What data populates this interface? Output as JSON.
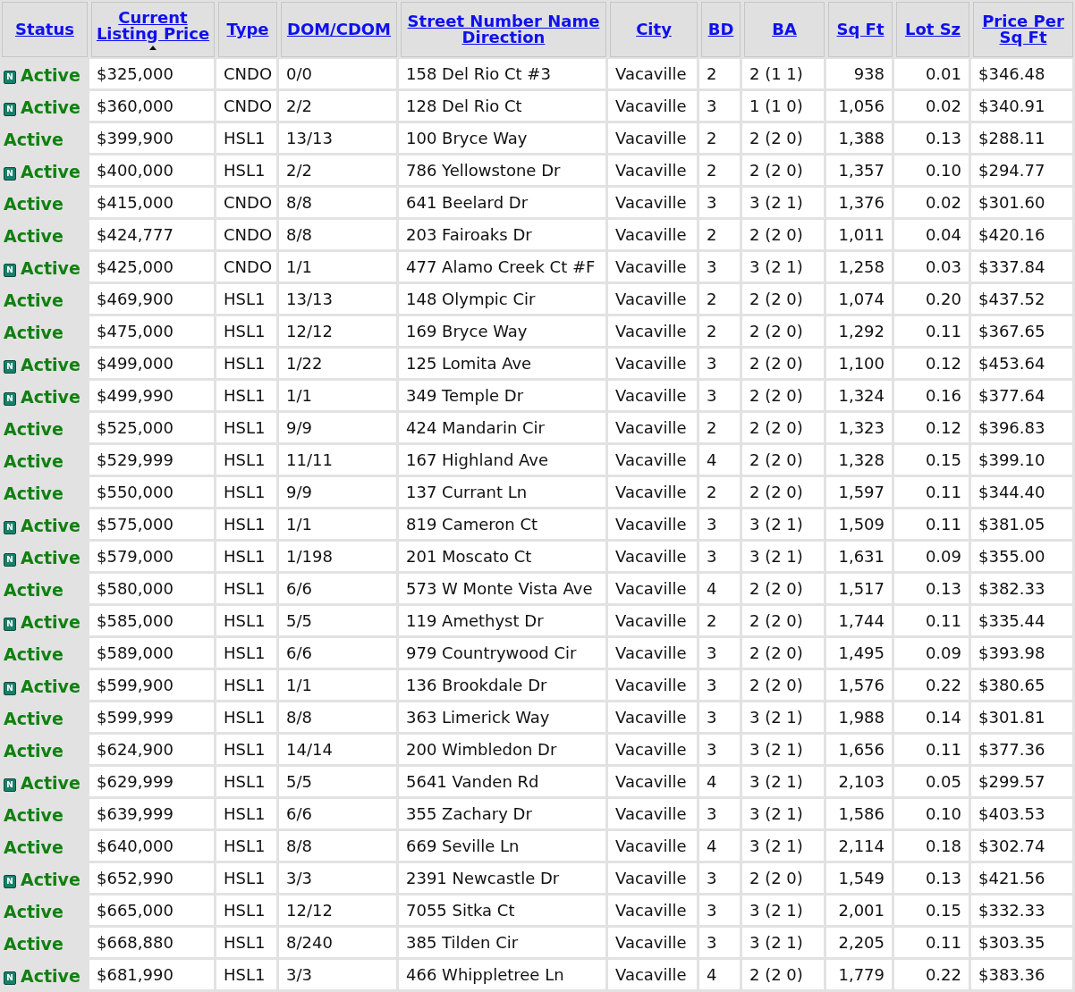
{
  "table": {
    "columns": [
      {
        "label": "Status",
        "sorted": false
      },
      {
        "label": "Current Listing Price",
        "sorted": true
      },
      {
        "label": "Type",
        "sorted": false
      },
      {
        "label": "DOM/CDOM",
        "sorted": false
      },
      {
        "label": "Street Number Name Direction",
        "sorted": false
      },
      {
        "label": "City",
        "sorted": false
      },
      {
        "label": "BD",
        "sorted": false
      },
      {
        "label": "BA",
        "sorted": false
      },
      {
        "label": "Sq Ft",
        "sorted": false
      },
      {
        "label": "Lot Sz",
        "sorted": false
      },
      {
        "label": "Price Per Sq Ft",
        "sorted": false
      }
    ],
    "rows": [
      {
        "badge": "N",
        "cells": [
          "Active",
          "$325,000",
          "CNDO",
          "0/0",
          "158 Del Rio Ct #3",
          "Vacaville",
          "2",
          "2 (1 1)",
          "938",
          "0.01",
          "$346.48"
        ]
      },
      {
        "badge": "N",
        "cells": [
          "Active",
          "$360,000",
          "CNDO",
          "2/2",
          "128 Del Rio Ct",
          "Vacaville",
          "3",
          "1 (1 0)",
          "1,056",
          "0.02",
          "$340.91"
        ]
      },
      {
        "cells": [
          "Active",
          "$399,900",
          "HSL1",
          "13/13",
          "100 Bryce Way",
          "Vacaville",
          "2",
          "2 (2 0)",
          "1,388",
          "0.13",
          "$288.11"
        ]
      },
      {
        "badge": "N",
        "cells": [
          "Active",
          "$400,000",
          "HSL1",
          "2/2",
          "786 Yellowstone Dr",
          "Vacaville",
          "2",
          "2 (2 0)",
          "1,357",
          "0.10",
          "$294.77"
        ]
      },
      {
        "cells": [
          "Active",
          "$415,000",
          "CNDO",
          "8/8",
          "641 Beelard Dr",
          "Vacaville",
          "3",
          "3 (2 1)",
          "1,376",
          "0.02",
          "$301.60"
        ]
      },
      {
        "cells": [
          "Active",
          "$424,777",
          "CNDO",
          "8/8",
          "203 Fairoaks Dr",
          "Vacaville",
          "2",
          "2 (2 0)",
          "1,011",
          "0.04",
          "$420.16"
        ]
      },
      {
        "badge": "N",
        "cells": [
          "Active",
          "$425,000",
          "CNDO",
          "1/1",
          "477 Alamo Creek Ct #F",
          "Vacaville",
          "3",
          "3 (2 1)",
          "1,258",
          "0.03",
          "$337.84"
        ]
      },
      {
        "cells": [
          "Active",
          "$469,900",
          "HSL1",
          "13/13",
          "148 Olympic Cir",
          "Vacaville",
          "2",
          "2 (2 0)",
          "1,074",
          "0.20",
          "$437.52"
        ]
      },
      {
        "cells": [
          "Active",
          "$475,000",
          "HSL1",
          "12/12",
          "169 Bryce Way",
          "Vacaville",
          "2",
          "2 (2 0)",
          "1,292",
          "0.11",
          "$367.65"
        ]
      },
      {
        "badge": "N",
        "cells": [
          "Active",
          "$499,000",
          "HSL1",
          "1/22",
          "125 Lomita Ave",
          "Vacaville",
          "3",
          "2 (2 0)",
          "1,100",
          "0.12",
          "$453.64"
        ]
      },
      {
        "badge": "N",
        "cells": [
          "Active",
          "$499,990",
          "HSL1",
          "1/1",
          "349 Temple Dr",
          "Vacaville",
          "3",
          "2 (2 0)",
          "1,324",
          "0.16",
          "$377.64"
        ]
      },
      {
        "cells": [
          "Active",
          "$525,000",
          "HSL1",
          "9/9",
          "424 Mandarin Cir",
          "Vacaville",
          "2",
          "2 (2 0)",
          "1,323",
          "0.12",
          "$396.83"
        ]
      },
      {
        "cells": [
          "Active",
          "$529,999",
          "HSL1",
          "11/11",
          "167 Highland Ave",
          "Vacaville",
          "4",
          "2 (2 0)",
          "1,328",
          "0.15",
          "$399.10"
        ]
      },
      {
        "cells": [
          "Active",
          "$550,000",
          "HSL1",
          "9/9",
          "137 Currant Ln",
          "Vacaville",
          "2",
          "2 (2 0)",
          "1,597",
          "0.11",
          "$344.40"
        ]
      },
      {
        "badge": "N",
        "cells": [
          "Active",
          "$575,000",
          "HSL1",
          "1/1",
          "819 Cameron Ct",
          "Vacaville",
          "3",
          "3 (2 1)",
          "1,509",
          "0.11",
          "$381.05"
        ]
      },
      {
        "badge": "N",
        "cells": [
          "Active",
          "$579,000",
          "HSL1",
          "1/198",
          "201 Moscato Ct",
          "Vacaville",
          "3",
          "3 (2 1)",
          "1,631",
          "0.09",
          "$355.00"
        ]
      },
      {
        "cells": [
          "Active",
          "$580,000",
          "HSL1",
          "6/6",
          "573 W Monte Vista Ave",
          "Vacaville",
          "4",
          "2 (2 0)",
          "1,517",
          "0.13",
          "$382.33"
        ]
      },
      {
        "badge": "N",
        "cells": [
          "Active",
          "$585,000",
          "HSL1",
          "5/5",
          "119 Amethyst Dr",
          "Vacaville",
          "2",
          "2 (2 0)",
          "1,744",
          "0.11",
          "$335.44"
        ]
      },
      {
        "cells": [
          "Active",
          "$589,000",
          "HSL1",
          "6/6",
          "979 Countrywood Cir",
          "Vacaville",
          "3",
          "2 (2 0)",
          "1,495",
          "0.09",
          "$393.98"
        ]
      },
      {
        "badge": "N",
        "cells": [
          "Active",
          "$599,900",
          "HSL1",
          "1/1",
          "136 Brookdale Dr",
          "Vacaville",
          "3",
          "2 (2 0)",
          "1,576",
          "0.22",
          "$380.65"
        ]
      },
      {
        "cells": [
          "Active",
          "$599,999",
          "HSL1",
          "8/8",
          "363 Limerick Way",
          "Vacaville",
          "3",
          "3 (2 1)",
          "1,988",
          "0.14",
          "$301.81"
        ]
      },
      {
        "cells": [
          "Active",
          "$624,900",
          "HSL1",
          "14/14",
          "200 Wimbledon Dr",
          "Vacaville",
          "3",
          "3 (2 1)",
          "1,656",
          "0.11",
          "$377.36"
        ]
      },
      {
        "badge": "N",
        "cells": [
          "Active",
          "$629,999",
          "HSL1",
          "5/5",
          "5641 Vanden Rd",
          "Vacaville",
          "4",
          "3 (2 1)",
          "2,103",
          "0.05",
          "$299.57"
        ]
      },
      {
        "cells": [
          "Active",
          "$639,999",
          "HSL1",
          "6/6",
          "355 Zachary Dr",
          "Vacaville",
          "3",
          "3 (2 1)",
          "1,586",
          "0.10",
          "$403.53"
        ]
      },
      {
        "cells": [
          "Active",
          "$640,000",
          "HSL1",
          "8/8",
          "669 Seville Ln",
          "Vacaville",
          "4",
          "3 (2 1)",
          "2,114",
          "0.18",
          "$302.74"
        ]
      },
      {
        "badge": "N",
        "cells": [
          "Active",
          "$652,990",
          "HSL1",
          "3/3",
          "2391 Newcastle Dr",
          "Vacaville",
          "3",
          "2 (2 0)",
          "1,549",
          "0.13",
          "$421.56"
        ]
      },
      {
        "cells": [
          "Active",
          "$665,000",
          "HSL1",
          "12/12",
          "7055 Sitka Ct",
          "Vacaville",
          "3",
          "3 (2 1)",
          "2,001",
          "0.15",
          "$332.33"
        ]
      },
      {
        "cells": [
          "Active",
          "$668,880",
          "HSL1",
          "8/240",
          "385 Tilden Cir",
          "Vacaville",
          "3",
          "3 (2 1)",
          "2,205",
          "0.11",
          "$303.35"
        ]
      },
      {
        "badge": "N",
        "cells": [
          "Active",
          "$681,990",
          "HSL1",
          "3/3",
          "466 Whippletree Ln",
          "Vacaville",
          "4",
          "2 (2 0)",
          "1,779",
          "0.22",
          "$383.36"
        ]
      }
    ]
  }
}
